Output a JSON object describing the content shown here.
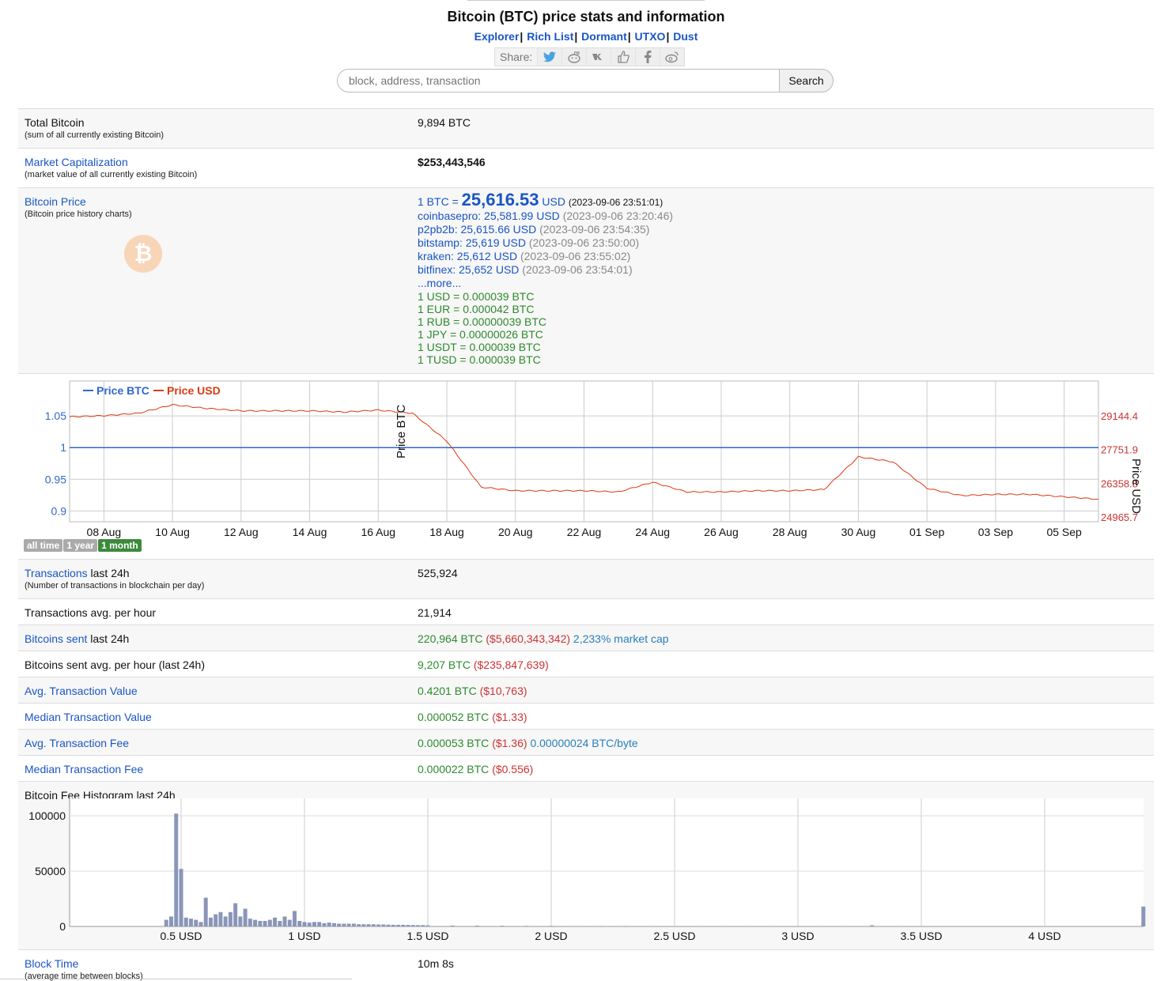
{
  "header": {
    "title": "Bitcoin (BTC) price stats and information",
    "nav": [
      "Explorer",
      "Rich List",
      "Dormant",
      "UTXO",
      "Dust"
    ],
    "share_label": "Share:",
    "search_placeholder": "block, address, transaction",
    "search_button": "Search"
  },
  "stats": {
    "total": {
      "label": "Total Bitcoin",
      "sub": "(sum of all currently existing Bitcoin)",
      "value": "9,894 BTC"
    },
    "mcap": {
      "label": "Market Capitalization",
      "sub": "(market value of all currently existing Bitcoin)",
      "value": "$253,443,546"
    },
    "price": {
      "label": "Bitcoin Price",
      "sub": "(Bitcoin price history charts)",
      "prefix": "1 BTC =",
      "main_value": "25,616.53",
      "main_unit": "USD",
      "main_time": "(2023-09-06 23:51:01)",
      "exchanges": [
        {
          "name": "coinbasepro: 25,581.99 USD",
          "time": "(2023-09-06 23:20:46)"
        },
        {
          "name": "p2pb2b: 25,615.66 USD",
          "time": "(2023-09-06 23:54:35)"
        },
        {
          "name": "bitstamp: 25,619 USD",
          "time": "(2023-09-06 23:50:00)"
        },
        {
          "name": "kraken: 25,612 USD",
          "time": "(2023-09-06 23:55:02)"
        },
        {
          "name": "bitfinex: 25,652 USD",
          "time": "(2023-09-06 23:54:01)"
        }
      ],
      "more": "...more...",
      "conversions": [
        "1 USD = 0.000039 BTC",
        "1 EUR = 0.000042 BTC",
        "1 RUB = 0.00000039 BTC",
        "1 JPY = 0.00000026 BTC",
        "1 USDT = 0.000039 BTC",
        "1 TUSD = 0.000039 BTC"
      ]
    },
    "tx24": {
      "label": "Transactions",
      "label2": "last 24h",
      "sub": "(Number of transactions in blockchain per day)",
      "value": "525,924"
    },
    "txhour": {
      "label": "Transactions avg. per hour",
      "value": "21,914"
    },
    "sent24": {
      "label": "Bitcoins sent",
      "label2": "last 24h",
      "btc": "220,964 BTC",
      "usd": "($5,660,343,342)",
      "pct": "2,233% market cap"
    },
    "senthour": {
      "label": "Bitcoins sent avg. per hour (last 24h)",
      "btc": "9,207 BTC",
      "usd": "($235,847,639)"
    },
    "avgval": {
      "label": "Avg. Transaction Value",
      "btc": "0.4201 BTC",
      "usd": "($10,763)"
    },
    "medval": {
      "label": "Median Transaction Value",
      "btc": "0.000052 BTC",
      "usd": "($1.33)"
    },
    "avgfee": {
      "label": "Avg. Transaction Fee",
      "btc": "0.000053 BTC",
      "usd": "($1.36)",
      "perbyte": "0.00000024 BTC/byte"
    },
    "medfee": {
      "label": "Median Transaction Fee",
      "btc": "0.000022 BTC",
      "usd": "($0.556)"
    },
    "hist": {
      "label": "Bitcoin Fee Histogram last 24h"
    },
    "blocktime": {
      "label": "Block Time",
      "sub": "(average time between blocks)",
      "value": "10m 8s"
    }
  },
  "range_buttons": [
    "all time",
    "1 year",
    "1 month"
  ],
  "chart_data": [
    {
      "type": "line",
      "title": "",
      "x": [
        "07 Aug",
        "08 Aug",
        "09 Aug",
        "10 Aug",
        "11 Aug",
        "12 Aug",
        "13 Aug",
        "14 Aug",
        "15 Aug",
        "16 Aug",
        "17 Aug",
        "18 Aug",
        "19 Aug",
        "20 Aug",
        "21 Aug",
        "22 Aug",
        "23 Aug",
        "24 Aug",
        "25 Aug",
        "26 Aug",
        "27 Aug",
        "28 Aug",
        "29 Aug",
        "30 Aug",
        "31 Aug",
        "01 Sep",
        "02 Sep",
        "03 Sep",
        "04 Sep",
        "05 Sep",
        "06 Sep"
      ],
      "xticks": [
        "08 Aug",
        "10 Aug",
        "12 Aug",
        "14 Aug",
        "16 Aug",
        "18 Aug",
        "20 Aug",
        "22 Aug",
        "24 Aug",
        "26 Aug",
        "28 Aug",
        "30 Aug",
        "01 Sep",
        "03 Sep",
        "05 Sep"
      ],
      "ylabel": "Price BTC",
      "y2label": "Price USD",
      "yticks": [
        "0.9",
        "0.95",
        "1",
        "1.05"
      ],
      "y2ticks": [
        "24965.7",
        "26358.8",
        "27751.9",
        "29144.4"
      ],
      "legend_placement": "top-left",
      "series": [
        {
          "name": "Price BTC",
          "color": "#3366cc",
          "axis": "left",
          "values": [
            1,
            1,
            1,
            1,
            1,
            1,
            1,
            1,
            1,
            1,
            1,
            1,
            1,
            1,
            1,
            1,
            1,
            1,
            1,
            1,
            1,
            1,
            1,
            1,
            1,
            1,
            1,
            1,
            1,
            1,
            1
          ]
        },
        {
          "name": "Price USD",
          "color": "#dc3912",
          "axis": "right",
          "values": [
            29100,
            29150,
            29250,
            29600,
            29450,
            29350,
            29350,
            29350,
            29300,
            29380,
            29250,
            28100,
            26200,
            26050,
            26050,
            26050,
            26000,
            26400,
            26000,
            26000,
            26050,
            26050,
            26100,
            27450,
            27250,
            26150,
            25850,
            25900,
            25900,
            25800,
            25700
          ]
        }
      ]
    },
    {
      "type": "bar",
      "title": "Bitcoin Fee Histogram last 24h",
      "xticks": [
        "0.5 USD",
        "1 USD",
        "1.5 USD",
        "2 USD",
        "2.5 USD",
        "3 USD",
        "3.5 USD",
        "4 USD"
      ],
      "yticks": [
        "0",
        "50000",
        "100000"
      ],
      "color": "#8a96b8",
      "bin_width_usd": 0.02,
      "x": [
        0.44,
        0.46,
        0.48,
        0.5,
        0.52,
        0.54,
        0.56,
        0.58,
        0.6,
        0.62,
        0.64,
        0.66,
        0.68,
        0.7,
        0.72,
        0.74,
        0.76,
        0.78,
        0.8,
        0.82,
        0.84,
        0.86,
        0.88,
        0.9,
        0.92,
        0.94,
        0.96,
        0.98,
        1.0,
        1.02,
        1.04,
        1.06,
        1.08,
        1.1,
        1.12,
        1.14,
        1.16,
        1.18,
        1.2,
        1.22,
        1.24,
        1.26,
        1.28,
        1.3,
        1.32,
        1.34,
        1.36,
        1.38,
        1.4,
        1.42,
        1.44,
        1.46,
        1.48,
        1.5,
        1.6,
        1.7,
        1.8,
        1.9,
        2.0,
        2.1,
        2.2,
        2.3,
        2.4,
        2.5,
        2.6,
        2.7,
        2.8,
        2.9,
        3.0,
        3.1,
        3.2,
        3.3,
        3.4,
        3.5,
        3.6,
        3.7,
        3.8,
        3.9,
        4.0,
        4.1,
        4.2,
        4.3,
        4.4
      ],
      "values": [
        6000,
        9000,
        102000,
        52000,
        8000,
        7000,
        6000,
        4000,
        26000,
        8000,
        11000,
        13000,
        9000,
        13000,
        21000,
        9000,
        16000,
        7000,
        6000,
        5000,
        5000,
        6000,
        8000,
        5000,
        9000,
        6000,
        14000,
        5000,
        4000,
        3500,
        4000,
        4000,
        3000,
        3500,
        3000,
        2500,
        2500,
        2500,
        2500,
        2000,
        2000,
        2000,
        2000,
        1800,
        1800,
        1600,
        1500,
        1500,
        1500,
        1400,
        1300,
        1200,
        1200,
        1000,
        800,
        700,
        600,
        500,
        500,
        400,
        400,
        400,
        350,
        300,
        300,
        300,
        300,
        250,
        250,
        250,
        250,
        1000,
        250,
        250,
        200,
        200,
        200,
        200,
        200,
        200,
        200,
        200,
        18000
      ]
    }
  ]
}
